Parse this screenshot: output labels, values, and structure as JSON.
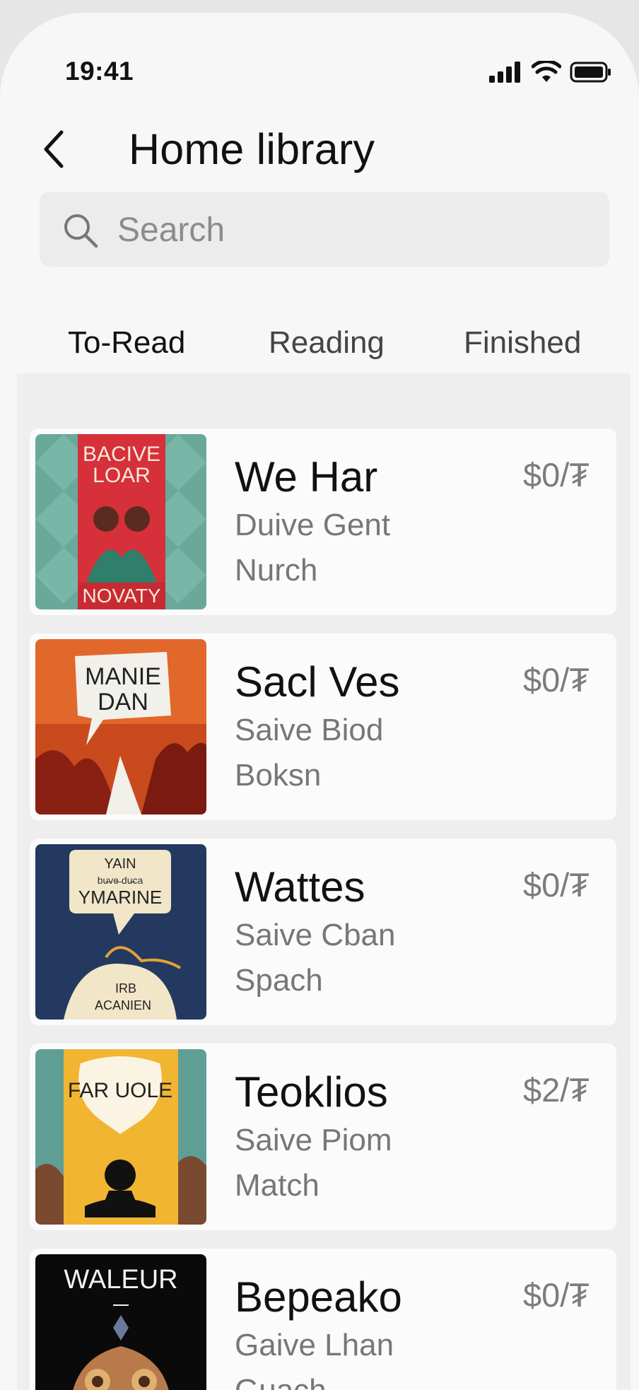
{
  "status_bar": {
    "time": "19:41"
  },
  "header": {
    "title": "Home library",
    "back_icon": "chevron-left-icon"
  },
  "search": {
    "placeholder": "Search",
    "value": ""
  },
  "tabs": [
    {
      "label": "To-Read",
      "active": true
    },
    {
      "label": "Reading",
      "active": false
    },
    {
      "label": "Finished",
      "active": false
    }
  ],
  "books": [
    {
      "title": "We Har",
      "line1": "Duive Gent",
      "line2": "Nurch",
      "price": "$0/₮",
      "cover_text": [
        "BACIVE",
        "LOAR",
        "NOVATY"
      ],
      "cover_colors": [
        "#6aa89a",
        "#d6303a",
        "#2f7f6a"
      ]
    },
    {
      "title": "Sacl Ves",
      "line1": "Saive Biod",
      "line2": "Boksn",
      "price": "$0/₮",
      "cover_text": [
        "MANIE",
        "DAN"
      ],
      "cover_colors": [
        "#e2672b",
        "#8a1f14",
        "#f2f0ea"
      ]
    },
    {
      "title": "Wattes",
      "line1": "Saive Cban",
      "line2": "Spach",
      "price": "$0/₮",
      "cover_text": [
        "YAIN",
        "bu̶ve̶ du̶ca",
        "YMARINE",
        "IRB",
        "ACANIEN"
      ],
      "cover_colors": [
        "#23395f",
        "#f1e6c8",
        "#e2a23a"
      ]
    },
    {
      "title": "Teoklios",
      "line1": "Saive Piom",
      "line2": "Match",
      "price": "$2/₮",
      "cover_text": [
        "FAR UOLE"
      ],
      "cover_colors": [
        "#f1b531",
        "#5f9e95",
        "#111111"
      ]
    },
    {
      "title": "Bepeako",
      "line1": "Gaive Lhan",
      "line2": "Guach",
      "price": "$0/₮",
      "cover_text": [
        "WALEUR"
      ],
      "cover_colors": [
        "#0a0a0a",
        "#b87a4a",
        "#e0b070"
      ]
    }
  ]
}
